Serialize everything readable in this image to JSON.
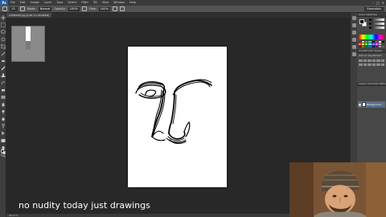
{
  "app": {
    "logo_text": "Ps",
    "menus": [
      "File",
      "Edit",
      "Image",
      "Layer",
      "Type",
      "Select",
      "Filter",
      "3D",
      "View",
      "Window",
      "Help"
    ],
    "window_controls": [
      "–",
      "□",
      "×"
    ]
  },
  "options_bar": {
    "brush_size": "13",
    "mode_label": "Mode:",
    "mode_value": "Normal",
    "opacity_label": "Opacity:",
    "opacity_value": "100%",
    "flow_label": "Flow:",
    "flow_value": "100%",
    "workspace": "Essentials"
  },
  "document": {
    "tab_label": "COMPOSE.jpg @ 66.7% (RGB/8#)",
    "status": "66.67%"
  },
  "panels": {
    "color_tab": "Color  Swatches",
    "adjustments_tab": "Adjustments  Styles",
    "add_adjustment": "Add an adjustment",
    "layers_tab": "Layers  Channels  Paths",
    "layer_name": "Background"
  },
  "swatch_colors": [
    "#ff0000",
    "#ffff00",
    "#00ff00",
    "#00ffff",
    "#0000ff",
    "#ff00ff",
    "#ffffff",
    "#000000",
    "#ff8080",
    "#ffff80",
    "#80ff80",
    "#80ffff",
    "#8080ff",
    "#ff80ff",
    "#c0c0c0",
    "#404040",
    "#800000",
    "#808000",
    "#008000",
    "#008080",
    "#000080",
    "#800080",
    "#a0a0a0",
    "#606060"
  ],
  "video_caption": "no nudity today just drawings"
}
